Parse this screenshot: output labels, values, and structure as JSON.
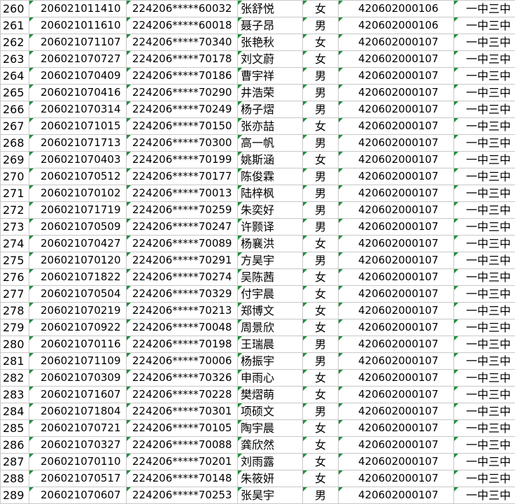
{
  "rows": [
    {
      "n": "260",
      "id": "206021011410",
      "card": "224206*****60032",
      "name": "张舒悦",
      "sex": "女",
      "code": "420602000106",
      "school": "一中三中"
    },
    {
      "n": "261",
      "id": "206021011610",
      "card": "224206*****60018",
      "name": "聂子昂",
      "sex": "男",
      "code": "420602000106",
      "school": "一中三中"
    },
    {
      "n": "262",
      "id": "206021071107",
      "card": "224206*****70340",
      "name": "张艳秋",
      "sex": "女",
      "code": "420602000107",
      "school": "一中三中"
    },
    {
      "n": "263",
      "id": "206021070727",
      "card": "224206*****70178",
      "name": "刘文蔚",
      "sex": "女",
      "code": "420602000107",
      "school": "一中三中"
    },
    {
      "n": "264",
      "id": "206021070409",
      "card": "224206*****70186",
      "name": "曹宇祥",
      "sex": "男",
      "code": "420602000107",
      "school": "一中三中"
    },
    {
      "n": "265",
      "id": "206021070416",
      "card": "224206*****70290",
      "name": "井浩荣",
      "sex": "男",
      "code": "420602000107",
      "school": "一中三中"
    },
    {
      "n": "266",
      "id": "206021070314",
      "card": "224206*****70249",
      "name": "杨子熠",
      "sex": "男",
      "code": "420602000107",
      "school": "一中三中"
    },
    {
      "n": "267",
      "id": "206021071015",
      "card": "224206*****70150",
      "name": "张亦喆",
      "sex": "女",
      "code": "420602000107",
      "school": "一中三中"
    },
    {
      "n": "268",
      "id": "206021071713",
      "card": "224206*****70300",
      "name": "高一帆",
      "sex": "男",
      "code": "420602000107",
      "school": "一中三中"
    },
    {
      "n": "269",
      "id": "206021070403",
      "card": "224206*****70199",
      "name": "姚斯涵",
      "sex": "女",
      "code": "420602000107",
      "school": "一中三中"
    },
    {
      "n": "270",
      "id": "206021070512",
      "card": "224206*****70177",
      "name": "陈俊霖",
      "sex": "男",
      "code": "420602000107",
      "school": "一中三中"
    },
    {
      "n": "271",
      "id": "206021070102",
      "card": "224206*****70013",
      "name": "陆梓枫",
      "sex": "男",
      "code": "420602000107",
      "school": "一中三中"
    },
    {
      "n": "272",
      "id": "206021071719",
      "card": "224206*****70259",
      "name": "朱奕好",
      "sex": "男",
      "code": "420602000107",
      "school": "一中三中"
    },
    {
      "n": "273",
      "id": "206021070509",
      "card": "224206*****70247",
      "name": "许颢译",
      "sex": "男",
      "code": "420602000107",
      "school": "一中三中"
    },
    {
      "n": "274",
      "id": "206021070427",
      "card": "224206*****70089",
      "name": "杨襄洪",
      "sex": "女",
      "code": "420602000107",
      "school": "一中三中"
    },
    {
      "n": "275",
      "id": "206021070120",
      "card": "224206*****70291",
      "name": "方昊宇",
      "sex": "男",
      "code": "420602000107",
      "school": "一中三中"
    },
    {
      "n": "276",
      "id": "206021071822",
      "card": "224206*****70274",
      "name": "吴陈茜",
      "sex": "女",
      "code": "420602000107",
      "school": "一中三中"
    },
    {
      "n": "277",
      "id": "206021070504",
      "card": "224206*****70329",
      "name": "付宇晨",
      "sex": "女",
      "code": "420602000107",
      "school": "一中三中"
    },
    {
      "n": "278",
      "id": "206021070219",
      "card": "224206*****70213",
      "name": "郑博文",
      "sex": "女",
      "code": "420602000107",
      "school": "一中三中"
    },
    {
      "n": "279",
      "id": "206021070922",
      "card": "224206*****70048",
      "name": "周景欣",
      "sex": "女",
      "code": "420602000107",
      "school": "一中三中"
    },
    {
      "n": "280",
      "id": "206021070116",
      "card": "224206*****70198",
      "name": "王瑞晨",
      "sex": "男",
      "code": "420602000107",
      "school": "一中三中"
    },
    {
      "n": "281",
      "id": "206021071109",
      "card": "224206*****70006",
      "name": "杨振宇",
      "sex": "男",
      "code": "420602000107",
      "school": "一中三中"
    },
    {
      "n": "282",
      "id": "206021070309",
      "card": "224206*****70326",
      "name": "申雨心",
      "sex": "女",
      "code": "420602000107",
      "school": "一中三中"
    },
    {
      "n": "283",
      "id": "206021071607",
      "card": "224206*****70228",
      "name": "樊熠萌",
      "sex": "女",
      "code": "420602000107",
      "school": "一中三中"
    },
    {
      "n": "284",
      "id": "206021071804",
      "card": "224206*****70301",
      "name": "项硕文",
      "sex": "男",
      "code": "420602000107",
      "school": "一中三中"
    },
    {
      "n": "285",
      "id": "206021070721",
      "card": "224206*****70105",
      "name": "陶宇晨",
      "sex": "女",
      "code": "420602000107",
      "school": "一中三中"
    },
    {
      "n": "286",
      "id": "206021070327",
      "card": "224206*****70088",
      "name": "龚欣然",
      "sex": "女",
      "code": "420602000107",
      "school": "一中三中"
    },
    {
      "n": "287",
      "id": "206021070110",
      "card": "224206*****70201",
      "name": "刘雨露",
      "sex": "女",
      "code": "420602000107",
      "school": "一中三中"
    },
    {
      "n": "288",
      "id": "206021070517",
      "card": "224206*****70148",
      "name": "朱筱妍",
      "sex": "女",
      "code": "420602000107",
      "school": "一中三中"
    },
    {
      "n": "289",
      "id": "206021070607",
      "card": "224206*****70253",
      "name": "张昊宇",
      "sex": "男",
      "code": "420602000107",
      "school": "一中三中"
    }
  ]
}
